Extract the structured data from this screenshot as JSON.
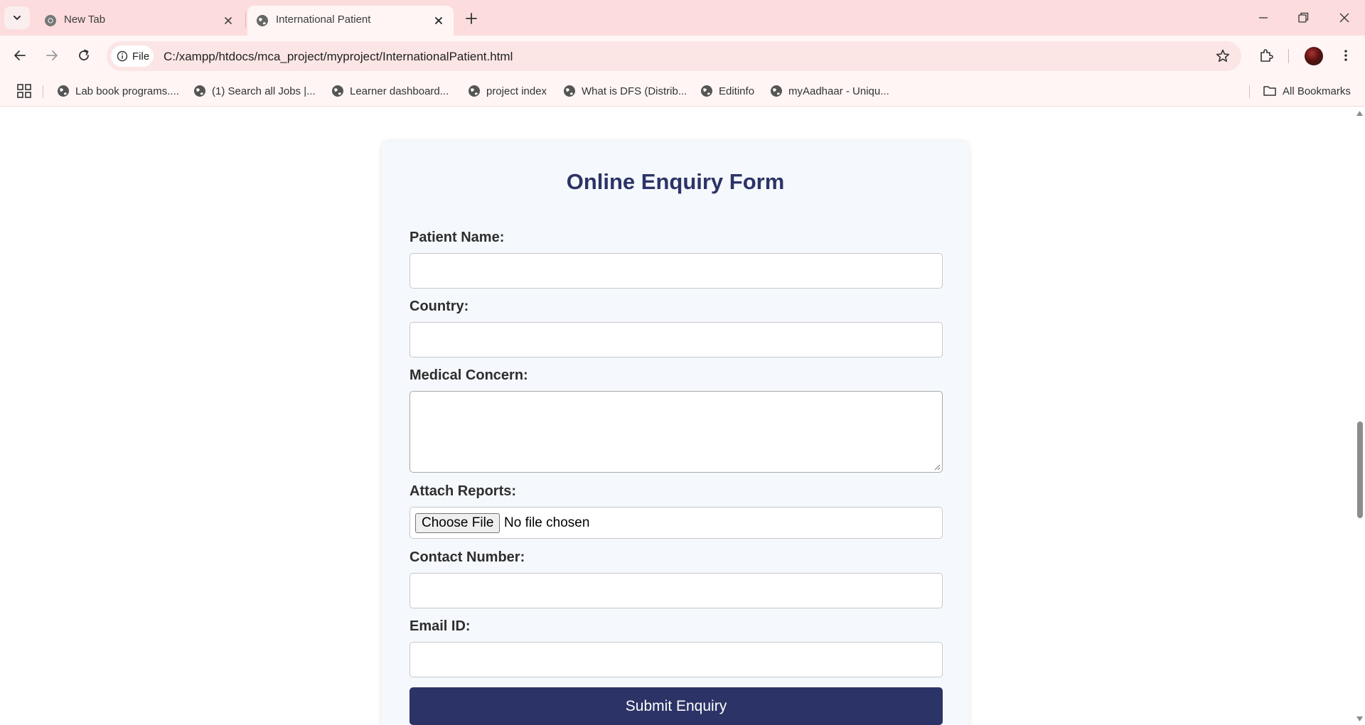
{
  "browser": {
    "tabs": [
      {
        "title": "New Tab",
        "icon": "chrome-icon",
        "active": false
      },
      {
        "title": "International Patient",
        "icon": "globe-icon",
        "active": true
      }
    ],
    "address_bar": {
      "chip_label": "File",
      "url": "C:/xampp/htdocs/mca_project/myproject/InternationalPatient.html"
    },
    "bookmarks": [
      "Lab book programs....",
      "(1) Search all Jobs |...",
      "Learner dashboard...",
      "project index",
      "What is DFS (Distrib...",
      "Editinfo",
      "myAadhaar - Uniqu..."
    ],
    "all_bookmarks_label": "All Bookmarks"
  },
  "form": {
    "title": "Online Enquiry Form",
    "patient_name_label": "Patient Name:",
    "country_label": "Country:",
    "medical_concern_label": "Medical Concern:",
    "attach_reports_label": "Attach Reports:",
    "choose_file_label": "Choose File",
    "file_status": "No file chosen",
    "contact_number_label": "Contact Number:",
    "email_label": "Email ID:",
    "submit_label": "Submit Enquiry"
  },
  "colors": {
    "tabstrip_bg": "#fcdcdc",
    "toolbar_bg": "#fff5f5",
    "form_heading": "#2c3366",
    "submit_bg": "#2c3366",
    "card_bg": "#f5f8fc"
  }
}
